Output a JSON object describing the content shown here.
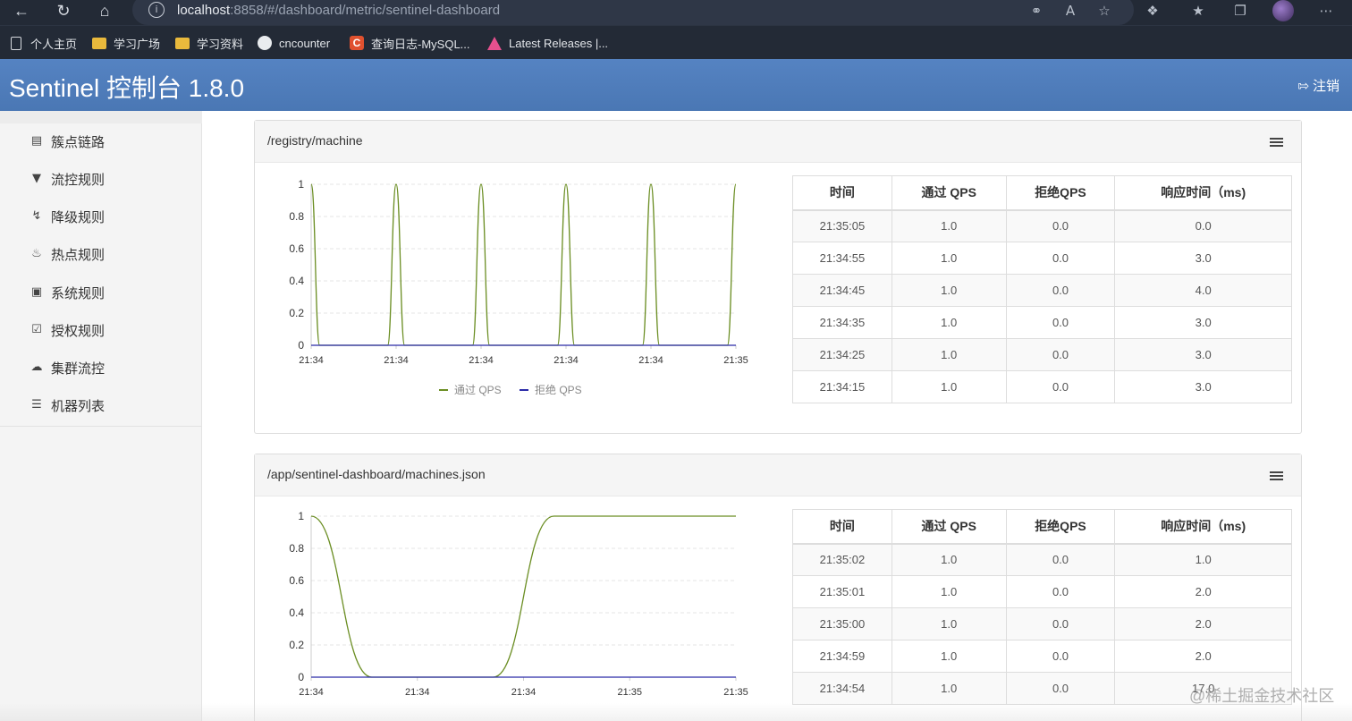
{
  "browser": {
    "url_host": "localhost",
    "url_rest": ":8858/#/dashboard/metric/sentinel-dashboard",
    "bookmarks": [
      {
        "label": "个人主页",
        "icon": "page-icon"
      },
      {
        "label": "学习广场",
        "icon": "folder-icon"
      },
      {
        "label": "学习资料",
        "icon": "folder-icon"
      },
      {
        "label": "cncounter",
        "icon": "github-icon"
      },
      {
        "label": "查询日志-MySQL...",
        "icon": "c-icon"
      },
      {
        "label": "Latest Releases |...",
        "icon": "triangle-icon"
      }
    ]
  },
  "header": {
    "title": "Sentinel 控制台 1.8.0",
    "logout_label": "注销"
  },
  "sidebar": {
    "items": [
      {
        "label": "簇点链路",
        "icon": "list-alt-icon"
      },
      {
        "label": "流控规则",
        "icon": "filter-icon"
      },
      {
        "label": "降级规则",
        "icon": "flash-icon"
      },
      {
        "label": "热点规则",
        "icon": "fire-icon"
      },
      {
        "label": "系统规则",
        "icon": "lock-icon"
      },
      {
        "label": "授权规则",
        "icon": "check-icon"
      },
      {
        "label": "集群流控",
        "icon": "cloud-icon"
      },
      {
        "label": "机器列表",
        "icon": "th-list-icon"
      }
    ]
  },
  "colors": {
    "header_bg": "#4d7ab8",
    "pass_series": "#6b8e23",
    "block_series": "#2b2ba8"
  },
  "table_headers": [
    "时间",
    "通过 QPS",
    "拒绝QPS",
    "响应时间（ms)"
  ],
  "panels": [
    {
      "title": "/registry/machine",
      "rows": [
        [
          "21:35:05",
          "1.0",
          "0.0",
          "0.0"
        ],
        [
          "21:34:55",
          "1.0",
          "0.0",
          "3.0"
        ],
        [
          "21:34:45",
          "1.0",
          "0.0",
          "4.0"
        ],
        [
          "21:34:35",
          "1.0",
          "0.0",
          "3.0"
        ],
        [
          "21:34:25",
          "1.0",
          "0.0",
          "3.0"
        ],
        [
          "21:34:15",
          "1.0",
          "0.0",
          "3.0"
        ]
      ]
    },
    {
      "title": "/app/sentinel-dashboard/machines.json",
      "rows": [
        [
          "21:35:02",
          "1.0",
          "0.0",
          "1.0"
        ],
        [
          "21:35:01",
          "1.0",
          "0.0",
          "2.0"
        ],
        [
          "21:35:00",
          "1.0",
          "0.0",
          "2.0"
        ],
        [
          "21:34:59",
          "1.0",
          "0.0",
          "2.0"
        ],
        [
          "21:34:54",
          "1.0",
          "0.0",
          "17.0"
        ]
      ]
    }
  ],
  "chart_data": [
    {
      "type": "line",
      "x_tick_labels": [
        "21:34",
        "21:34",
        "21:34",
        "21:34",
        "21:34",
        "21:35"
      ],
      "yticks": [
        0,
        0.2,
        0.4,
        0.6,
        0.8,
        1
      ],
      "ylim": [
        0,
        1
      ],
      "legend_position": "bottom",
      "series": [
        {
          "name": "通过 QPS",
          "values": [
            1,
            0,
            0,
            0,
            0,
            0,
            0,
            0,
            0,
            0,
            1,
            0,
            0,
            0,
            0,
            0,
            0,
            0,
            0,
            0,
            1,
            0,
            0,
            0,
            0,
            0,
            0,
            0,
            0,
            0,
            1,
            0,
            0,
            0,
            0,
            0,
            0,
            0,
            0,
            0,
            1,
            0,
            0,
            0,
            0,
            0,
            0,
            0,
            0,
            0,
            1
          ]
        },
        {
          "name": "拒绝 QPS",
          "values": [
            0,
            0,
            0,
            0,
            0,
            0,
            0,
            0,
            0,
            0,
            0,
            0,
            0,
            0,
            0,
            0,
            0,
            0,
            0,
            0,
            0,
            0,
            0,
            0,
            0,
            0,
            0,
            0,
            0,
            0,
            0,
            0,
            0,
            0,
            0,
            0,
            0,
            0,
            0,
            0,
            0,
            0,
            0,
            0,
            0,
            0,
            0,
            0,
            0,
            0,
            0
          ]
        }
      ]
    },
    {
      "type": "line",
      "x_tick_labels": [
        "21:34",
        "21:34",
        "21:34",
        "21:35",
        "21:35"
      ],
      "yticks": [
        0,
        0.2,
        0.4,
        0.6,
        0.8,
        1
      ],
      "ylim": [
        0,
        1
      ],
      "series": [
        {
          "name": "通过 QPS",
          "values": [
            1,
            0,
            0,
            0,
            1,
            1,
            1,
            1
          ]
        },
        {
          "name": "拒绝 QPS",
          "values": [
            0,
            0,
            0,
            0,
            0,
            0,
            0,
            0
          ]
        }
      ]
    }
  ],
  "watermark": "@稀土掘金技术社区"
}
